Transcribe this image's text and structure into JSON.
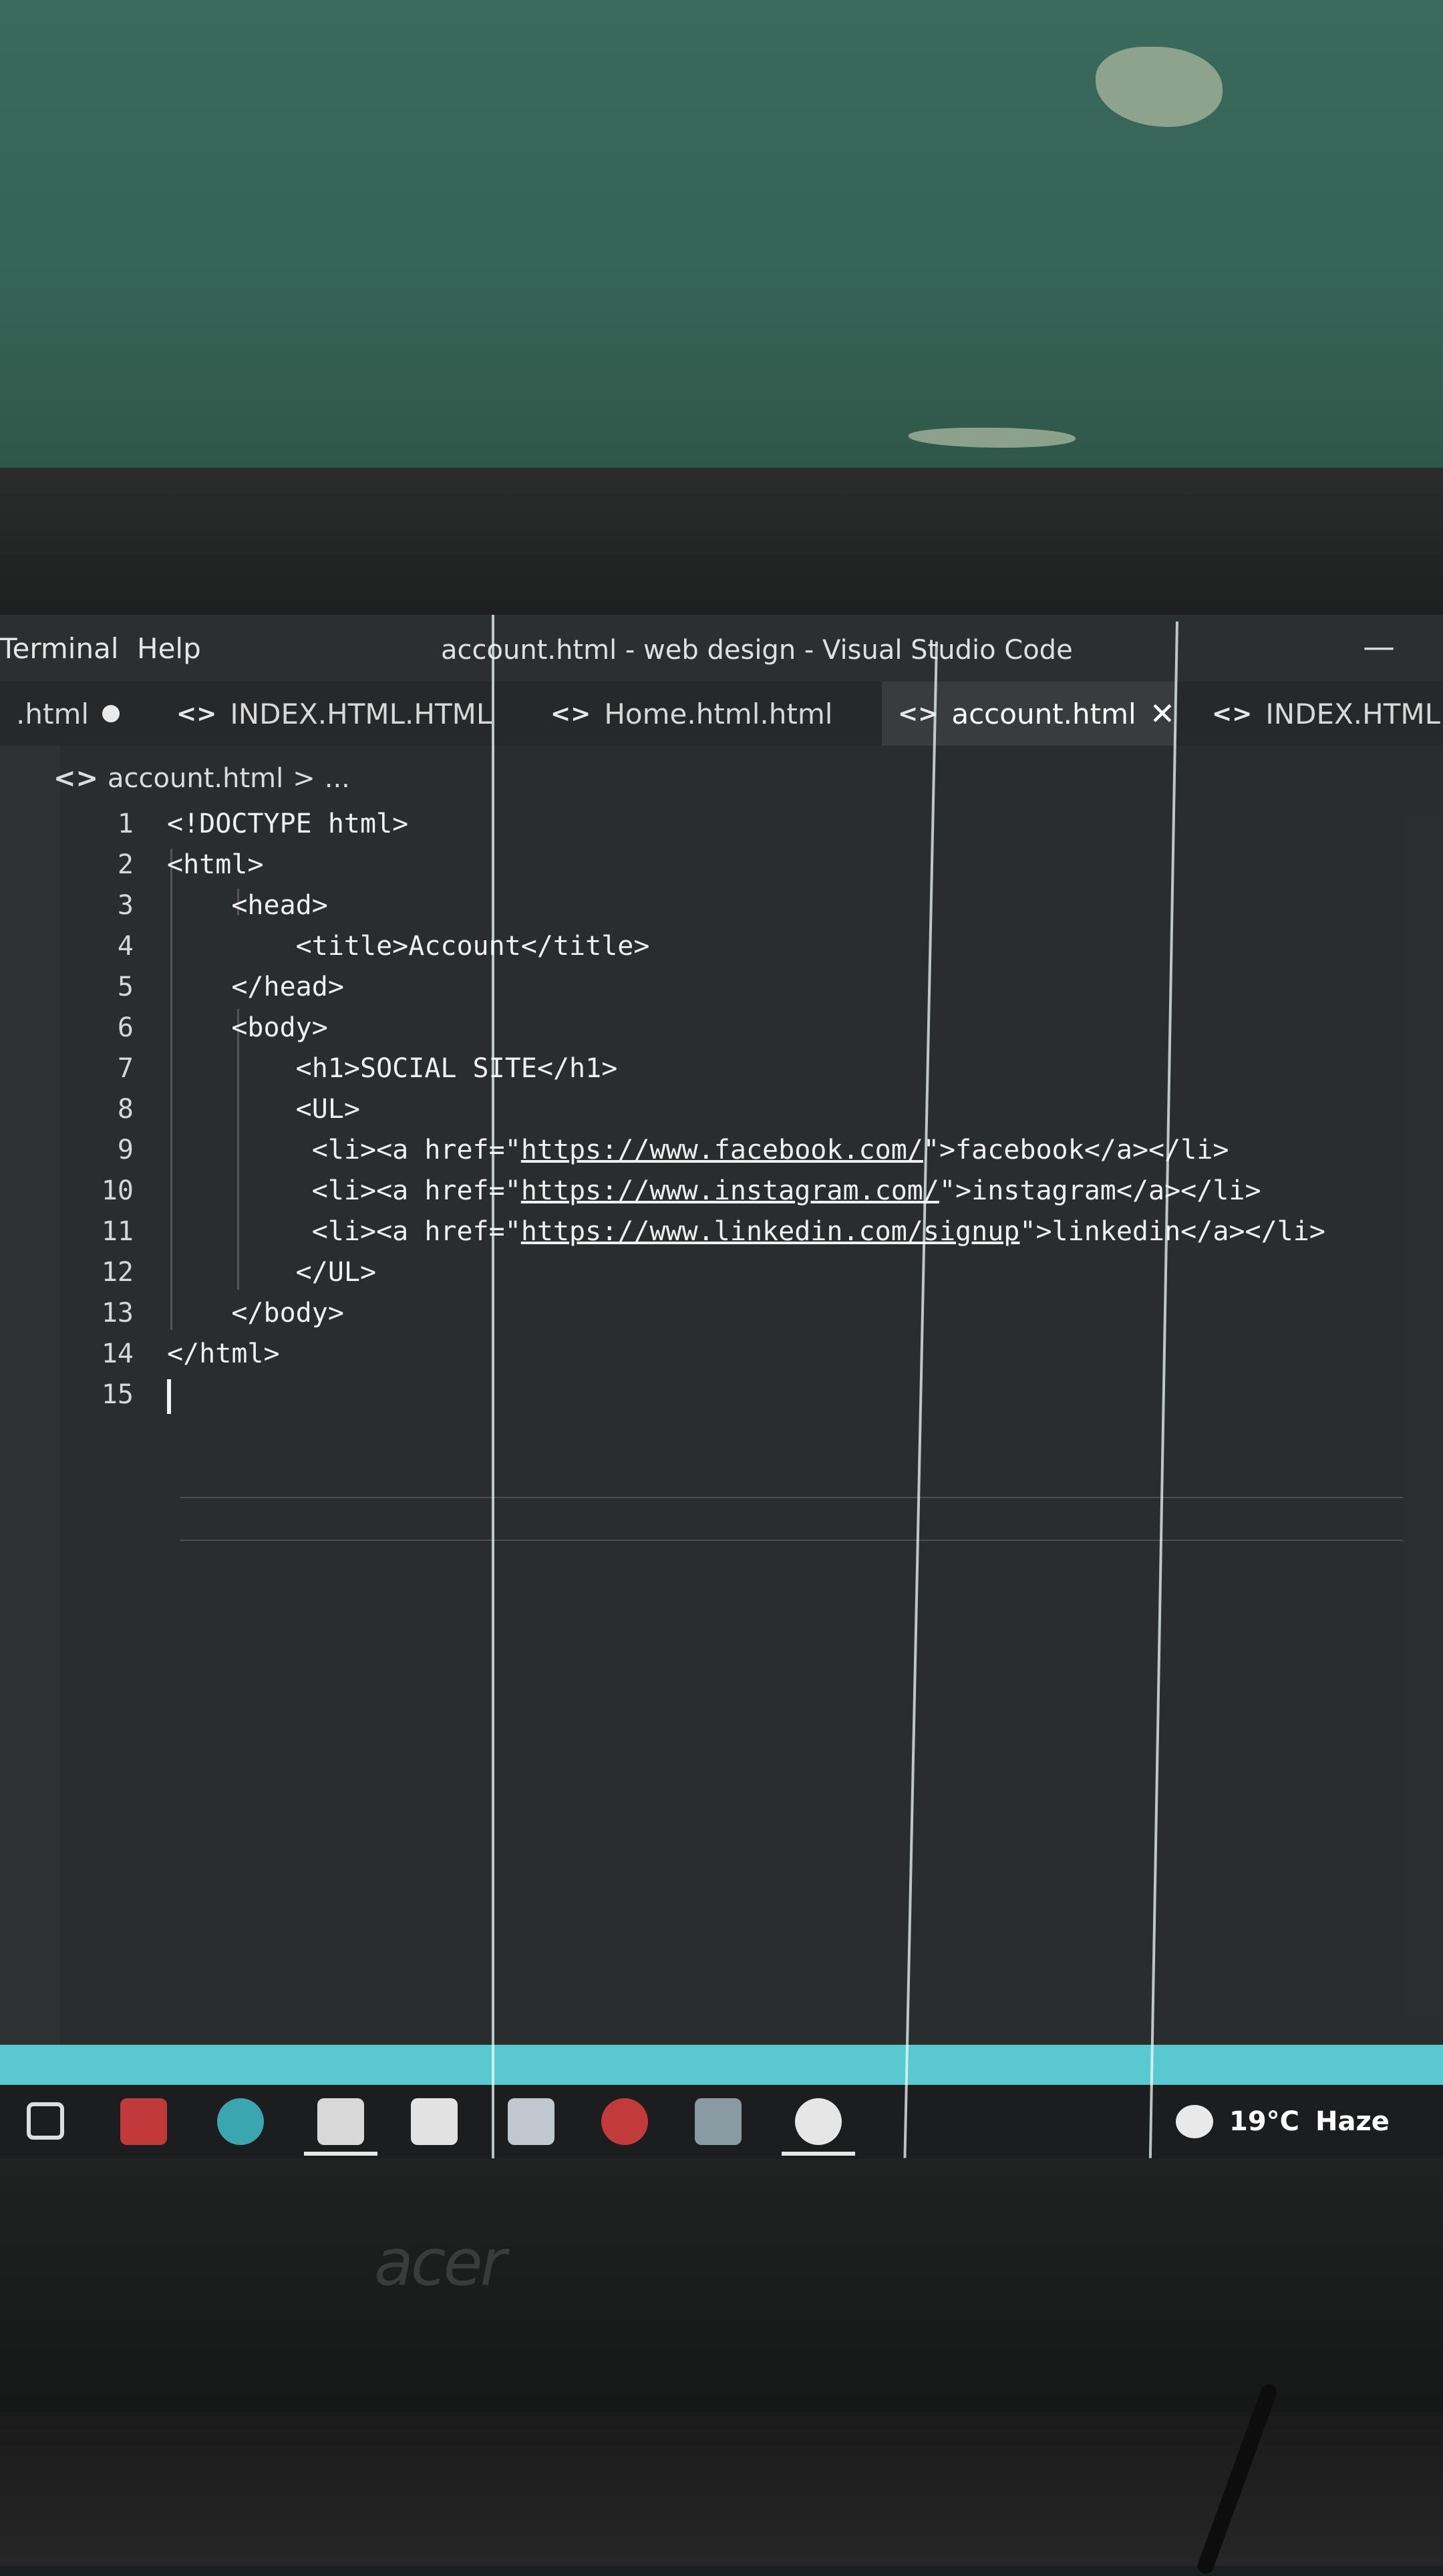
{
  "window": {
    "menu": [
      "Terminal",
      "Help"
    ],
    "title": "account.html - web design - Visual Studio Code",
    "minimize": "—"
  },
  "tabs": [
    {
      "label": ".html",
      "modified": true
    },
    {
      "label": "INDEX.HTML.HTML"
    },
    {
      "label": "Home.html.html"
    },
    {
      "label": "account.html",
      "active": true
    },
    {
      "label": "INDEX.HTML"
    }
  ],
  "breadcrumb": {
    "file": "account.html",
    "sep": ">",
    "more": "..."
  },
  "editor": {
    "lines": [
      {
        "n": "1",
        "text": "<!DOCTYPE html>"
      },
      {
        "n": "2",
        "text": "<html>"
      },
      {
        "n": "3",
        "text": "    <head>"
      },
      {
        "n": "4",
        "text": "        <title>Account</title>"
      },
      {
        "n": "5",
        "text": "    </head>"
      },
      {
        "n": "6",
        "text": "    <body>"
      },
      {
        "n": "7",
        "text": "        <h1>SOCIAL SITE</h1>"
      },
      {
        "n": "8",
        "text": "        <UL>"
      },
      {
        "n": "9",
        "pre": "         <li><a href=\"",
        "url": "https://www.facebook.com/",
        "post": "\">facebook</a></li>"
      },
      {
        "n": "10",
        "pre": "         <li><a href=\"",
        "url": "https://www.instagram.com/",
        "post": "\">instagram</a></li>"
      },
      {
        "n": "11",
        "pre": "         <li><a href=\"",
        "url": "https://www.linkedin.com/signup",
        "post": "\">linkedin</a></li>"
      },
      {
        "n": "12",
        "text": "        </UL>"
      },
      {
        "n": "13",
        "text": "    </body>"
      },
      {
        "n": "14",
        "text": "</html>"
      },
      {
        "n": "15",
        "text": ""
      }
    ]
  },
  "weather": {
    "temp": "19°C",
    "condition": "Haze"
  },
  "monitor_brand": "acer",
  "colors": {
    "statusbar": "#59c9cf",
    "editor_bg": "#2a2d2e"
  }
}
